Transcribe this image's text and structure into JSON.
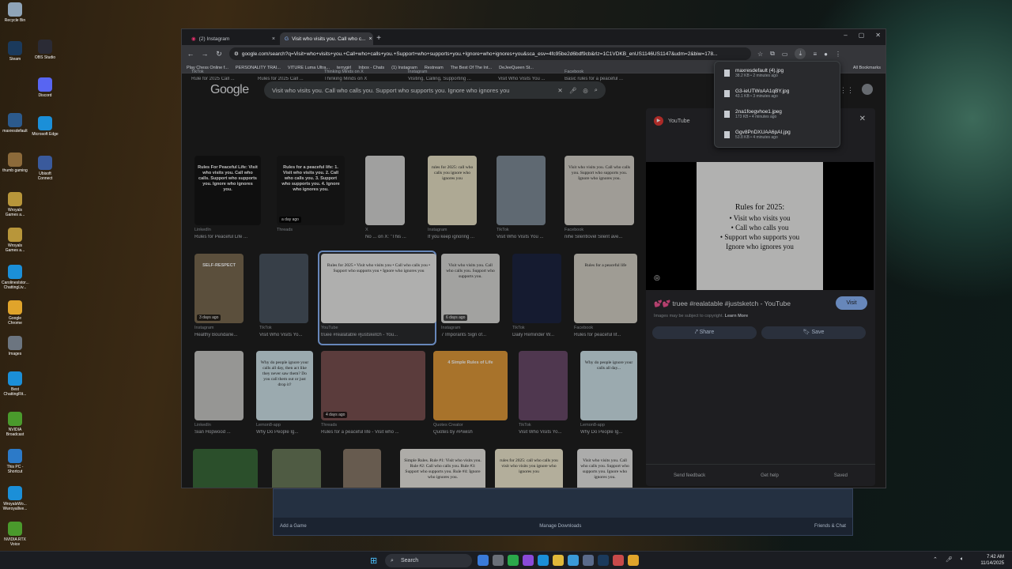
{
  "desktop": {
    "icons": [
      {
        "label": "Recycle Bin",
        "color": "#8fa4b8"
      },
      {
        "label": "OBS Studio",
        "color": "#2b2b35"
      },
      {
        "label": "Steam",
        "color": "#1b3a5c"
      },
      {
        "label": "Discord",
        "color": "#5865f2"
      },
      {
        "label": "maxresdefault",
        "color": "#2c5a8c"
      },
      {
        "label": "Microsoft Edge",
        "color": "#1b8fd8"
      },
      {
        "label": "thumb gaming",
        "color": "#8c6a3a"
      },
      {
        "label": "Ubisoft Connect",
        "color": "#3a5a9c"
      },
      {
        "label": "Wroyals Games a...",
        "color": "#b8963a"
      },
      {
        "label": "Wroyals Games a...",
        "color": "#b8963a"
      },
      {
        "label": "CarolinesIstor... ChattingLiv...",
        "color": "#1b8fd8"
      },
      {
        "label": "Google Chrome",
        "color": "#e0a42b"
      },
      {
        "label": "Images",
        "color": "#6c7580"
      },
      {
        "label": "Best ChattingRit...",
        "color": "#1b8fd8"
      },
      {
        "label": "NVIDIA Broadcast",
        "color": "#4a9a2c"
      },
      {
        "label": "This PC - Shortcut",
        "color": "#2c7ac8"
      },
      {
        "label": "WroyalsWo... Wwroyallive...",
        "color": "#1b8fd8"
      },
      {
        "label": "NVIDIA RTX Voice",
        "color": "#4a9a2c"
      }
    ]
  },
  "game_window": {
    "add_game": "Add a Game",
    "manage_downloads": "Manage Downloads",
    "friends": "Friends & Chat"
  },
  "browser": {
    "tabs": [
      {
        "label": "(2) Instagram"
      },
      {
        "label": "Visit who visits you. Call who c..."
      }
    ],
    "new_tab": "+",
    "url": "google.com/search?q=Visit+who+visits+you.+Call+who+calls+you.+Support+who+supports+you.+Ignore+who+ignores+you&sca_esv=4fc95be2d6bdf9cb&rlz=1C1VDKB_enUS1146US1147&udm=2&biw=178...",
    "bookmarks": [
      "Play Chess Online f...",
      "PERSONALITY TRAI...",
      "VITURE Luma Ultra...",
      "terrygirl",
      "Inbox - Chats",
      "(1) Instagram",
      "Restream",
      "The Best Of The Int...",
      "DeJeeQueen St..."
    ],
    "all_bookmarks": "All Bookmarks"
  },
  "google": {
    "logo": "Google",
    "query": "Visit who visits you. Call who calls you. Support who supports you. Ignore who ignores you",
    "row0": [
      {
        "src": "TikTok",
        "cap": "Rule for 2025 Call ..."
      },
      {
        "src": "",
        "cap": "Rules for 2025 Call ..."
      },
      {
        "src": "Thinking Minds on X",
        "cap": "Thinking Minds on X"
      },
      {
        "src": "Instagram",
        "cap": "Visiting, Calling, Supporting ..."
      },
      {
        "src": "",
        "cap": "Visit Who Visits You ..."
      },
      {
        "src": "Facebook",
        "cap": "Basic rules for a peaceful ..."
      }
    ],
    "row1": [
      {
        "src": "LinkedIn",
        "cap": "Rules for Peaceful Life ...",
        "text": "Rules For Peaceful Life: Visit who visits you. Call who calls. Support who supports you. Ignore who ignores you.",
        "bg": "#151515",
        "light": true
      },
      {
        "src": "Threads",
        "cap": "",
        "text": "Rules for a peaceful life: 1. Visit who visits you. 2. Call who calls you. 3. Support who supports you. 4. Ignore who ignores you.",
        "bg": "#1a1a1a",
        "light": true,
        "badge": "a day ago"
      },
      {
        "src": "X",
        "cap": "No ... on X: \"This ...",
        "text": "",
        "bg": "#d6d6d4",
        "light": false
      },
      {
        "src": "Instagram",
        "cap": "If you keep ignoring ...",
        "text": "rules for 2025: call who calls you ignore who ignores you",
        "bg": "#e8e2c6",
        "light": false
      },
      {
        "src": "TikTok",
        "cap": "Visit Who Visits You ...",
        "text": "",
        "bg": "#7f8c99",
        "light": false
      },
      {
        "src": "Facebook",
        "cap": "nihe Silentlovel Silent ave...",
        "text": "Visit who visits you. Call who calls you. Support who supports you. Ignore who ignores you.",
        "bg": "#d5d1c8",
        "light": false
      }
    ],
    "row2": [
      {
        "src": "Instagram",
        "cap": "Healthy Boundarie...",
        "text": "SELF-RESPECT",
        "bg": "#7a6a50",
        "light": true,
        "badge": "3 days ago"
      },
      {
        "src": "TikTok",
        "cap": "Visit Who Visits Yo...",
        "text": "",
        "bg": "#4a5560",
        "light": true
      },
      {
        "src": "YouTube",
        "cap": "truee #realatable #justsketch - You...",
        "text": "Rules for 2025 • Visit who visits you • Call who calls you • Support who supports you • Ignore who ignores you",
        "bg": "#eaeae8",
        "light": false
      },
      {
        "src": "Instagram",
        "cap": "7 Imporants Sign of...",
        "text": "Visit who visits you. Call who calls you. Support who supports you.",
        "bg": "#d9d9d6",
        "light": false,
        "badge": "6 days ago"
      },
      {
        "src": "TikTok",
        "cap": "Daily Reminder W...",
        "text": "",
        "bg": "#1c2440",
        "light": true
      },
      {
        "src": "Facebook",
        "cap": "Rules for peaceful lif...",
        "text": "Rules for a peaceful life",
        "bg": "#d4d0c6",
        "light": false
      }
    ],
    "row3": [
      {
        "src": "LinkedIn",
        "cap": "Sian Hopwood ...",
        "text": "",
        "bg": "#c8c8c6",
        "light": false
      },
      {
        "src": "Lemon8-app",
        "cap": "Why Do People Ig...",
        "text": "Why do people ignore your calls all day, then act like they never saw them? Do you call them out or just drop it?",
        "bg": "#cfe3ea",
        "light": false
      },
      {
        "src": "Threads",
        "cap": "Rules for a peaceful life - Visit who ...",
        "text": "",
        "bg": "#7a5050",
        "light": true,
        "badge": "4 days ago"
      },
      {
        "src": "Quotes Creator",
        "cap": "Quotes by #Piwish",
        "text": "4 Simple Rules of Life",
        "bg": "#e09a3a",
        "light": true
      },
      {
        "src": "TikTok",
        "cap": "Visit Who Visits Yo...",
        "text": "",
        "bg": "#6a4a6a",
        "light": true
      },
      {
        "src": "Lemon8-app",
        "cap": "Why Do People Ig...",
        "text": "Why do people ignore your calls all day...",
        "bg": "#cfe3ea",
        "light": false
      }
    ],
    "row4": [
      {
        "text": "",
        "bg": "#3a6a3a",
        "light": true
      },
      {
        "text": "",
        "bg": "#6a7a5a",
        "light": true
      },
      {
        "text": "",
        "bg": "#8a7a6a",
        "light": true
      },
      {
        "text": "Simple Rules. Rule #1: Visit who visits you. Rule #2: Call who calls you. Rule #3: Support who supports you. Rule #4: Ignore who ignores you.",
        "bg": "#e8e6e0",
        "light": false
      },
      {
        "text": "rules for 2025: call who calls you visit who visits you ignore who ignores you",
        "bg": "#efe9cf",
        "light": false
      },
      {
        "text": "Visit who visits you. Call who calls you. Support who supports you. Ignore who ignores you.",
        "bg": "#e6e6e4",
        "light": false
      }
    ]
  },
  "panel": {
    "source": "YouTube",
    "image_title": "Rules for 2025:",
    "image_lines": [
      "• Visit who visits you",
      "• Call who calls you",
      "• Support who supports you",
      "Ignore who ignores you"
    ],
    "title": "💕💕 truee #realatable #justsketch - YouTube",
    "visit": "Visit",
    "copyright": "Images may be subject to copyright.",
    "learn_more": "Learn More",
    "share": "Share",
    "save": "Save",
    "footer": [
      "Send feedback",
      "Get help",
      "Saved"
    ]
  },
  "downloads": [
    {
      "name": "maxresdefault (4).jpg",
      "meta": "38.2 KB • 2 minutes ago"
    },
    {
      "name": "G3-ieUTWoAA1qBY.jpg",
      "meta": "43.1 KB • 3 minutes ago"
    },
    {
      "name": "2na1foegvhoe1.jpeg",
      "meta": "173 KB • 4 minutes ago"
    },
    {
      "name": "Ggv8PnDXUAA6pAI.jpg",
      "meta": "53.8 KB • 4 minutes ago"
    }
  ],
  "taskbar": {
    "search": "Search",
    "time": "7:42 AM",
    "date": "11/14/2025"
  }
}
